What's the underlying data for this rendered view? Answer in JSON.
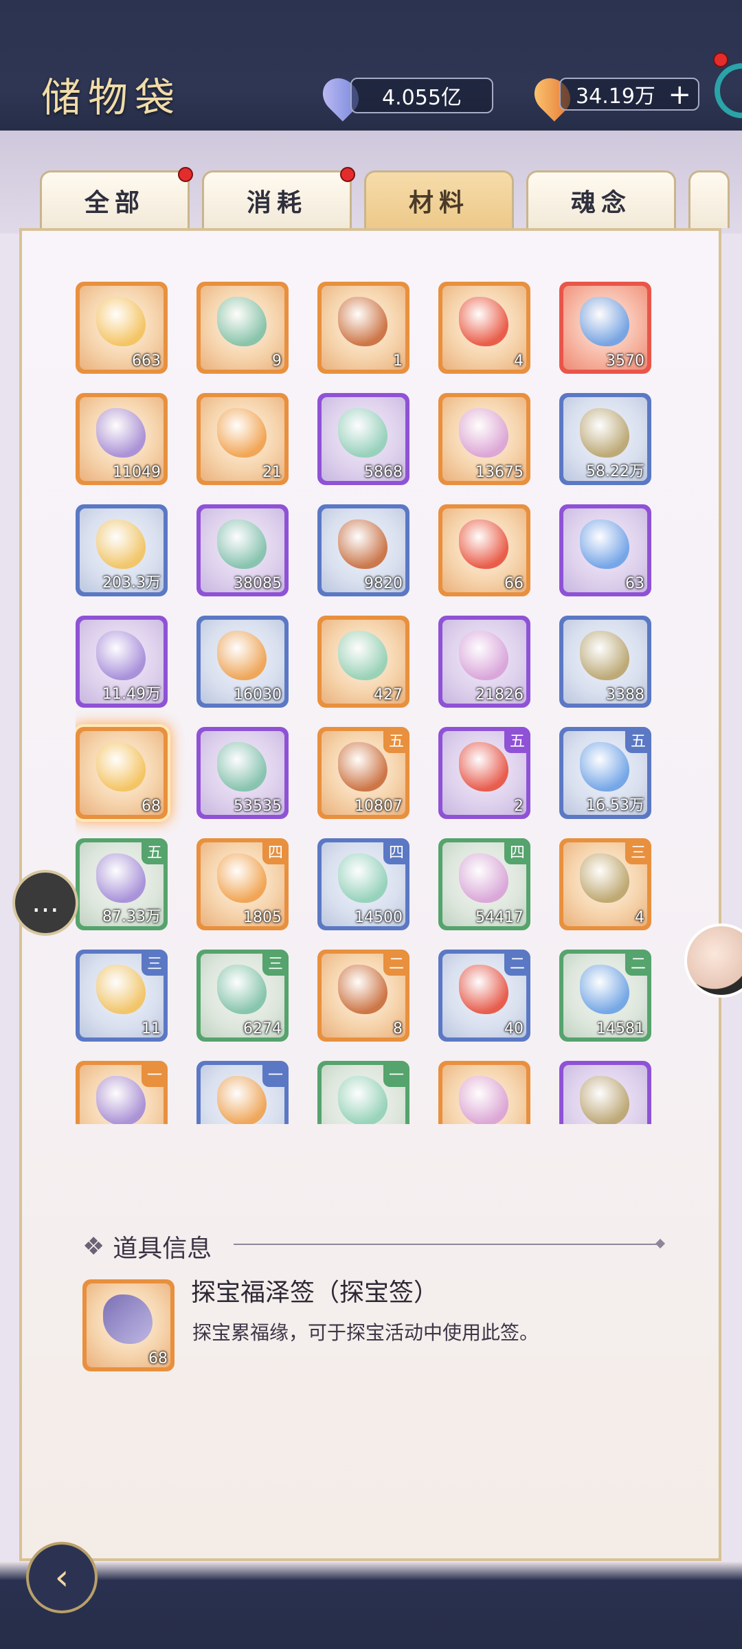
{
  "header": {
    "title": "储物袋",
    "currency1": {
      "value": "4.055亿",
      "icon": "spirit-stone-icon"
    },
    "currency2": {
      "value": "34.19万",
      "icon": "flame-gem-icon",
      "add": "+"
    }
  },
  "tabs": [
    {
      "label": "全部",
      "badge": true,
      "active": false
    },
    {
      "label": "消耗",
      "badge": true,
      "active": false
    },
    {
      "label": "材料",
      "badge": false,
      "active": true
    },
    {
      "label": "魂念",
      "badge": false,
      "active": false
    }
  ],
  "items": [
    {
      "count": "663",
      "rarity": "orange",
      "grade": ""
    },
    {
      "count": "9",
      "rarity": "orange",
      "grade": ""
    },
    {
      "count": "1",
      "rarity": "orange",
      "grade": ""
    },
    {
      "count": "4",
      "rarity": "orange",
      "grade": ""
    },
    {
      "count": "3570",
      "rarity": "red",
      "grade": ""
    },
    {
      "count": "11049",
      "rarity": "orange",
      "grade": ""
    },
    {
      "count": "21",
      "rarity": "orange",
      "grade": ""
    },
    {
      "count": "5868",
      "rarity": "purple",
      "grade": ""
    },
    {
      "count": "13675",
      "rarity": "orange",
      "grade": ""
    },
    {
      "count": "58.22万",
      "rarity": "blue",
      "grade": ""
    },
    {
      "count": "203.3万",
      "rarity": "blue",
      "grade": ""
    },
    {
      "count": "38085",
      "rarity": "purple",
      "grade": ""
    },
    {
      "count": "9820",
      "rarity": "blue",
      "grade": ""
    },
    {
      "count": "66",
      "rarity": "orange",
      "grade": ""
    },
    {
      "count": "63",
      "rarity": "purple",
      "grade": ""
    },
    {
      "count": "11.49万",
      "rarity": "purple",
      "grade": ""
    },
    {
      "count": "16030",
      "rarity": "blue",
      "grade": ""
    },
    {
      "count": "427",
      "rarity": "orange",
      "grade": ""
    },
    {
      "count": "21826",
      "rarity": "purple",
      "grade": ""
    },
    {
      "count": "3388",
      "rarity": "blue",
      "grade": ""
    },
    {
      "count": "68",
      "rarity": "orange",
      "grade": "",
      "selected": true
    },
    {
      "count": "53535",
      "rarity": "purple",
      "grade": ""
    },
    {
      "count": "10807",
      "rarity": "orange",
      "grade": "五"
    },
    {
      "count": "2",
      "rarity": "purple",
      "grade": "五"
    },
    {
      "count": "16.53万",
      "rarity": "blue",
      "grade": "五"
    },
    {
      "count": "87.33万",
      "rarity": "green",
      "grade": "五"
    },
    {
      "count": "1805",
      "rarity": "orange",
      "grade": "四"
    },
    {
      "count": "14500",
      "rarity": "blue",
      "grade": "四"
    },
    {
      "count": "54417",
      "rarity": "green",
      "grade": "四"
    },
    {
      "count": "4",
      "rarity": "orange",
      "grade": "三"
    },
    {
      "count": "11",
      "rarity": "blue",
      "grade": "三"
    },
    {
      "count": "6274",
      "rarity": "green",
      "grade": "三"
    },
    {
      "count": "8",
      "rarity": "orange",
      "grade": "二"
    },
    {
      "count": "40",
      "rarity": "blue",
      "grade": "二"
    },
    {
      "count": "14581",
      "rarity": "green",
      "grade": "二"
    },
    {
      "count": "",
      "rarity": "orange",
      "grade": "一"
    },
    {
      "count": "",
      "rarity": "blue",
      "grade": "一"
    },
    {
      "count": "",
      "rarity": "green",
      "grade": "一"
    },
    {
      "count": "",
      "rarity": "orange",
      "grade": ""
    },
    {
      "count": "",
      "rarity": "purple",
      "grade": ""
    }
  ],
  "info": {
    "heading": "道具信息",
    "heading_icon": "diamond-cluster-icon",
    "item_name": "探宝福泽签（探宝签）",
    "item_desc": "探宝累福缘，可于探宝活动中使用此签。",
    "item_count": "68",
    "item_rarity": "orange"
  },
  "colors": {
    "orange": "#e8903e",
    "purple": "#8f52d6",
    "blue": "#5b78c4",
    "green": "#55a36d",
    "red": "#e9554a",
    "gold": "#c8a86a"
  }
}
